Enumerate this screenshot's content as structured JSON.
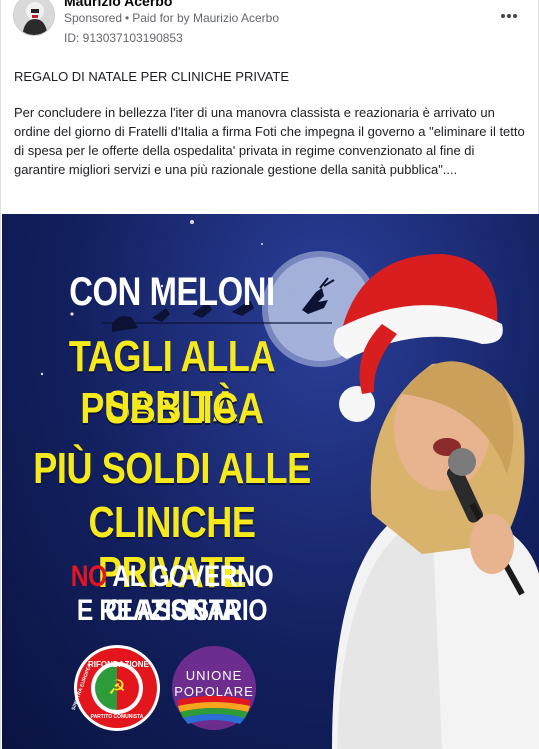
{
  "post": {
    "author": "Maurizio Acerbo",
    "sponsored_label": "Sponsored",
    "separator": "•",
    "paid_for": "Paid for by Maurizio Acerbo",
    "ad_id": "ID: 913037103190853",
    "headline": "REGALO DI NATALE PER CLINICHE PRIVATE",
    "body": "Per concludere in bellezza l'iter di una manovra classista e reazionaria è arrivato un ordine del giorno di Fratelli d'Italia a firma Foti che impegna il governo a \"eliminare il tetto di spesa per le offerte della ospedalita' privata in regime convenzionato al fine di garantire migliori servizi e una più razionale gestione della sanità pubblica\"....",
    "more_icon": "ellipsis-icon"
  },
  "creative": {
    "line1": "CON MELONI",
    "line2": "TAGLI ALLA SANITÀ",
    "line3": "PUBBLICA",
    "line4": "PIÙ SOLDI ALLE",
    "line5": "CLINICHE PRIVATE",
    "line6_no": "NO",
    "line6_rest": " AL GOVERNO CLASSISTA",
    "line7": "E REAZIONARIO",
    "logo1_top": "RIFONDAZIONE",
    "logo1_left": "SINISTRA EUROPEA",
    "logo1_bottom": "PARTITO COMUNISTA",
    "logo2_line1": "UNIONE",
    "logo2_line2": "POPOLARE",
    "colors": {
      "yellow": "#f6ea1c",
      "red": "#e3161d",
      "background": "#13205f"
    }
  }
}
